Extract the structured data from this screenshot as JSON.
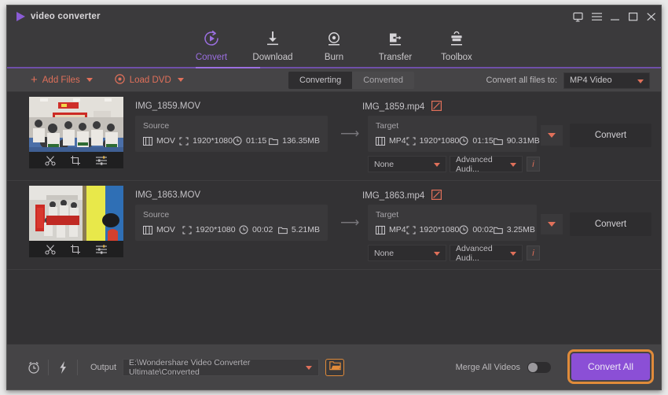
{
  "window": {
    "app_title": "video converter",
    "controls": [
      "feedback-icon",
      "menu-icon",
      "minimize-icon",
      "maximize-icon",
      "close-icon"
    ]
  },
  "nav": {
    "items": [
      {
        "label": "Convert",
        "icon": "convert-icon",
        "active": true
      },
      {
        "label": "Download",
        "icon": "download-icon",
        "active": false
      },
      {
        "label": "Burn",
        "icon": "burn-icon",
        "active": false
      },
      {
        "label": "Transfer",
        "icon": "transfer-icon",
        "active": false
      },
      {
        "label": "Toolbox",
        "icon": "toolbox-icon",
        "active": false
      }
    ],
    "accent": "#9b6fe0"
  },
  "toolbar": {
    "add_files_label": "Add Files",
    "load_dvd_label": "Load DVD",
    "tabs": [
      {
        "label": "Converting",
        "active": true
      },
      {
        "label": "Converted",
        "active": false
      }
    ],
    "convert_all_to_label": "Convert all files to:",
    "convert_all_to_value": "MP4 Video",
    "accent": "#e0705a"
  },
  "files": [
    {
      "source_name": "IMG_1859.MOV",
      "source": {
        "caption": "Source",
        "format": "MOV",
        "resolution": "1920*1080",
        "duration": "01:15",
        "size": "136.35MB"
      },
      "target_name": "IMG_1859.mp4",
      "target": {
        "caption": "Target",
        "format": "MP4",
        "resolution": "1920*1080",
        "duration": "01:15",
        "size": "90.31MB"
      },
      "convert_label": "Convert",
      "subtitle_value": "None",
      "audio_value": "Advanced Audi...",
      "info_label": "i"
    },
    {
      "source_name": "IMG_1863.MOV",
      "source": {
        "caption": "Source",
        "format": "MOV",
        "resolution": "1920*1080",
        "duration": "00:02",
        "size": "5.21MB"
      },
      "target_name": "IMG_1863.mp4",
      "target": {
        "caption": "Target",
        "format": "MP4",
        "resolution": "1920*1080",
        "duration": "00:02",
        "size": "3.25MB"
      },
      "convert_label": "Convert",
      "subtitle_value": "None",
      "audio_value": "Advanced Audi...",
      "info_label": "i"
    }
  ],
  "thumb_tools": [
    "trim-icon",
    "crop-icon",
    "effect-icon"
  ],
  "bottom": {
    "timer_icon": "alarm-clock-icon",
    "speed_icon": "lightning-bolt-icon",
    "output_label": "Output",
    "output_path": "E:\\Wondershare Video Converter Ultimate\\Converted",
    "folder_icon": "open-folder-icon",
    "merge_label": "Merge All Videos",
    "merge_on": false,
    "convert_all_label": "Convert All",
    "convert_all_color": "#8b4fd6",
    "highlight_color": "#e08b3a"
  }
}
